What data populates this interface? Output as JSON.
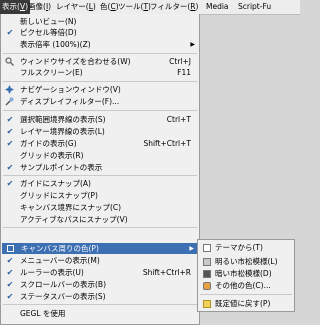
{
  "menubar": {
    "items": [
      {
        "label": "表示(",
        "accel": "V",
        "end": ")"
      },
      {
        "label": "画像(",
        "accel": "I",
        "end": ")"
      },
      {
        "label": "レイヤー(",
        "accel": "L",
        "end": ")"
      },
      {
        "label": "色(",
        "accel": "C",
        "end": ")"
      },
      {
        "label": "ツール(",
        "accel": "T",
        "end": ")"
      },
      {
        "label": "フィルター(",
        "accel": "R",
        "end": ")"
      },
      {
        "label": "Media",
        "accel": "",
        "end": ""
      },
      {
        "label": "Script-Fu",
        "accel": "",
        "end": ""
      }
    ]
  },
  "view_menu": {
    "new_view": {
      "label": "新しいビュー(N)"
    },
    "dot_for_dot": {
      "label": "ピクセル等倍(D)",
      "checked": true
    },
    "zoom": {
      "label": "表示倍率 (100%)(Z)"
    },
    "shrink_wrap": {
      "label": "ウィンドウサイズを合わせる(W)",
      "shortcut": "Ctrl+J"
    },
    "fullscreen": {
      "label": "フルスクリーン(E)",
      "shortcut": "F11"
    },
    "navigation": {
      "label": "ナビゲーションウィンドウ(V)"
    },
    "display_filters": {
      "label": "ディスプレイフィルター(F)..."
    },
    "show_selection": {
      "label": "選択範囲境界線の表示(S)",
      "shortcut": "Ctrl+T",
      "checked": true
    },
    "show_layer_boundary": {
      "label": "レイヤー境界線の表示(L)",
      "checked": true
    },
    "show_guides": {
      "label": "ガイドの表示(G)",
      "shortcut": "Shift+Ctrl+T",
      "checked": true
    },
    "show_grid": {
      "label": "グリッドの表示(R)"
    },
    "show_sample_points": {
      "label": "サンプルポイントの表示",
      "checked": true
    },
    "snap_guides": {
      "label": "ガイドにスナップ(A)",
      "checked": true
    },
    "snap_grid": {
      "label": "グリッドにスナップ(P)"
    },
    "snap_canvas": {
      "label": "キャンバス境界にスナップ(C)"
    },
    "snap_path": {
      "label": "アクティブなパスにスナップ(V)"
    },
    "padding_color": {
      "label": "キャンバス周りの色(P)"
    },
    "show_menubar": {
      "label": "メニューバーの表示(M)",
      "checked": true
    },
    "show_rulers": {
      "label": "ルーラーの表示(U)",
      "shortcut": "Shift+Ctrl+R",
      "checked": true
    },
    "show_scrollbars": {
      "label": "スクロールバーの表示(B)",
      "checked": true
    },
    "show_statusbar": {
      "label": "ステータスバーの表示(S)",
      "checked": true
    },
    "use_gegl": {
      "label": "GEGL を使用"
    }
  },
  "padding_submenu": {
    "items": [
      {
        "label": "テーマから(T)",
        "swatch": "#ffffff"
      },
      {
        "label": "明るい市松模様(L)",
        "swatch": "#c8c8c8"
      },
      {
        "label": "暗い市松模様(D)",
        "swatch": "#555555"
      },
      {
        "label": "その他の色(C)...",
        "swatch": "#e8a040"
      },
      {
        "label": "既定値に戻す(P)",
        "swatch": "#f0d060"
      }
    ]
  },
  "colors": {
    "highlight": "#3d6fb3",
    "check": "#2c5ea8"
  }
}
